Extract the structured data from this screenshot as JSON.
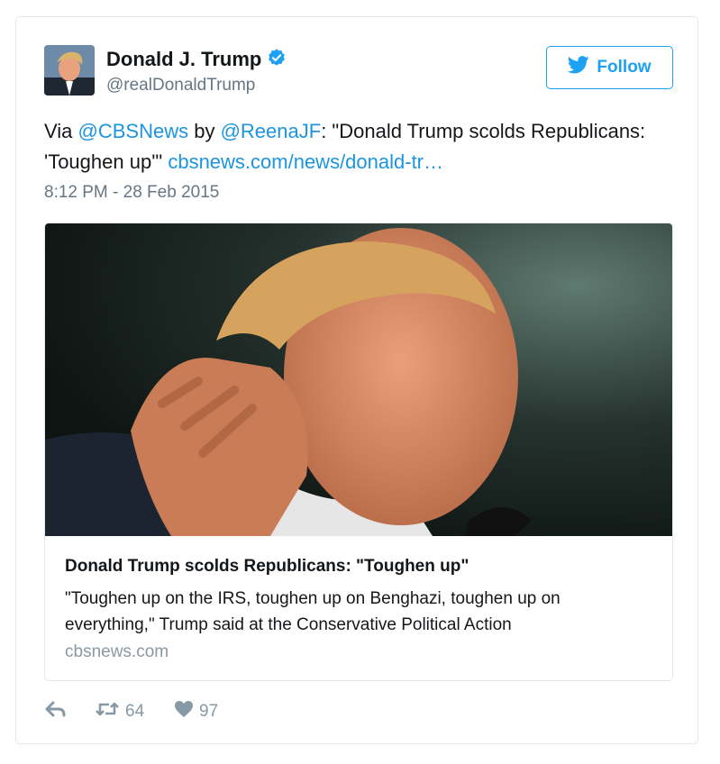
{
  "author": {
    "name": "Donald J. Trump",
    "handle": "@realDonaldTrump",
    "avatar_icon": "profile-photo"
  },
  "follow_button": {
    "label": "Follow",
    "icon": "twitter-bird-icon"
  },
  "tweet": {
    "prefix": "Via ",
    "mention1": "@CBSNews",
    "by": " by ",
    "mention2": "@ReenaJF",
    "body": ": \"Donald Trump scolds Republicans: 'Toughen up'\" ",
    "link": "cbsnews.com/news/donald-tr…",
    "timestamp": "8:12 PM - 28 Feb 2015"
  },
  "card": {
    "title": "Donald Trump scolds Republicans: \"Toughen up\"",
    "description": "\"Toughen up on the IRS, toughen up on Benghazi, toughen up on everything,\" Trump said at the Conservative Political Action",
    "domain": "cbsnews.com"
  },
  "actions": {
    "retweet_count": "64",
    "like_count": "97"
  },
  "colors": {
    "accent": "#1da1f2",
    "link": "#1b95e0",
    "muted": "#657786"
  }
}
